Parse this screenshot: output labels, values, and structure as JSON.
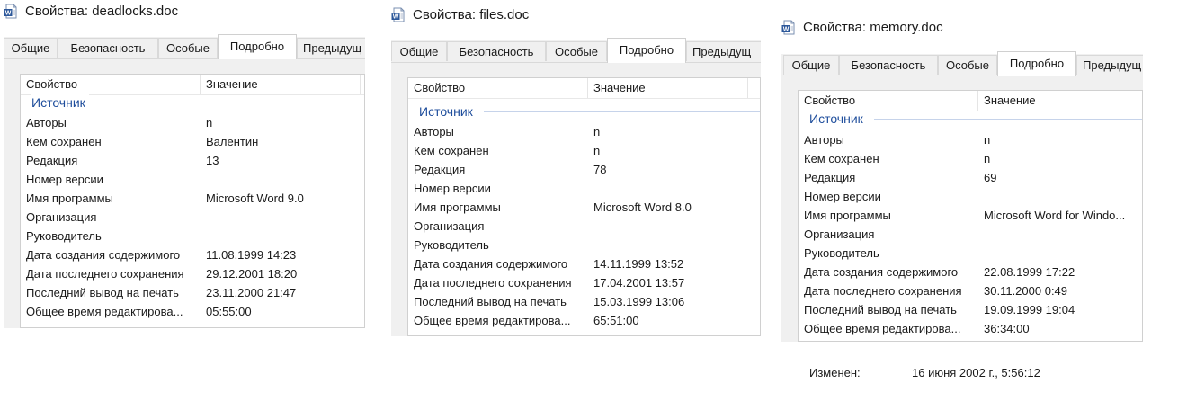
{
  "windows": [
    {
      "title": "Свойства: deadlocks.doc",
      "tabs": [
        "Общие",
        "Безопасность",
        "Особые",
        "Подробно",
        "Предыдущ"
      ],
      "active_tab": 3,
      "columns": [
        "Свойство",
        "Значение"
      ],
      "group": "Источник",
      "rows": [
        [
          "Авторы",
          "n"
        ],
        [
          "Кем сохранен",
          "Валентин"
        ],
        [
          "Редакция",
          "13"
        ],
        [
          "Номер версии",
          ""
        ],
        [
          "Имя программы",
          "Microsoft Word 9.0"
        ],
        [
          "Организация",
          ""
        ],
        [
          "Руководитель",
          ""
        ],
        [
          "Дата создания содержимого",
          "11.08.1999 14:23"
        ],
        [
          "Дата последнего сохранения",
          "29.12.2001 18:20"
        ],
        [
          "Последний вывод на печать",
          "23.11.2000 21:47"
        ],
        [
          "Общее время редактирова...",
          "05:55:00"
        ]
      ]
    },
    {
      "title": "Свойства: files.doc",
      "tabs": [
        "Общие",
        "Безопасность",
        "Особые",
        "Подробно",
        "Предыдущ"
      ],
      "active_tab": 3,
      "columns": [
        "Свойство",
        "Значение"
      ],
      "group": "Источник",
      "rows": [
        [
          "Авторы",
          "n"
        ],
        [
          "Кем сохранен",
          "n"
        ],
        [
          "Редакция",
          "78"
        ],
        [
          "Номер версии",
          ""
        ],
        [
          "Имя программы",
          "Microsoft Word 8.0"
        ],
        [
          "Организация",
          ""
        ],
        [
          "Руководитель",
          ""
        ],
        [
          "Дата создания содержимого",
          "14.11.1999 13:52"
        ],
        [
          "Дата последнего сохранения",
          "17.04.2001 13:57"
        ],
        [
          "Последний вывод на печать",
          "15.03.1999 13:06"
        ],
        [
          "Общее время редактирова...",
          "65:51:00"
        ]
      ]
    },
    {
      "title": "Свойства: memory.doc",
      "tabs": [
        "Общие",
        "Безопасность",
        "Особые",
        "Подробно",
        "Предыдущ"
      ],
      "active_tab": 3,
      "columns": [
        "Свойство",
        "Значение"
      ],
      "group": "Источник",
      "rows": [
        [
          "Авторы",
          "n"
        ],
        [
          "Кем сохранен",
          "n"
        ],
        [
          "Редакция",
          "69"
        ],
        [
          "Номер версии",
          ""
        ],
        [
          "Имя программы",
          "Microsoft Word for Windo..."
        ],
        [
          "Организация",
          ""
        ],
        [
          "Руководитель",
          ""
        ],
        [
          "Дата создания содержимого",
          "22.08.1999 17:22"
        ],
        [
          "Дата последнего сохранения",
          "30.11.2000 0:49"
        ],
        [
          "Последний вывод на печать",
          "19.09.1999 19:04"
        ],
        [
          "Общее время редактирова...",
          "36:34:00"
        ]
      ],
      "footer": {
        "label": "Изменен:",
        "value": "16 июня 2002 г., 5:56:12"
      }
    }
  ],
  "icon": "word-document-icon",
  "colors": {
    "group_label": "#1f4e9c",
    "tab_strip": "#f0f0f0",
    "word_blue": "#2b579a"
  }
}
